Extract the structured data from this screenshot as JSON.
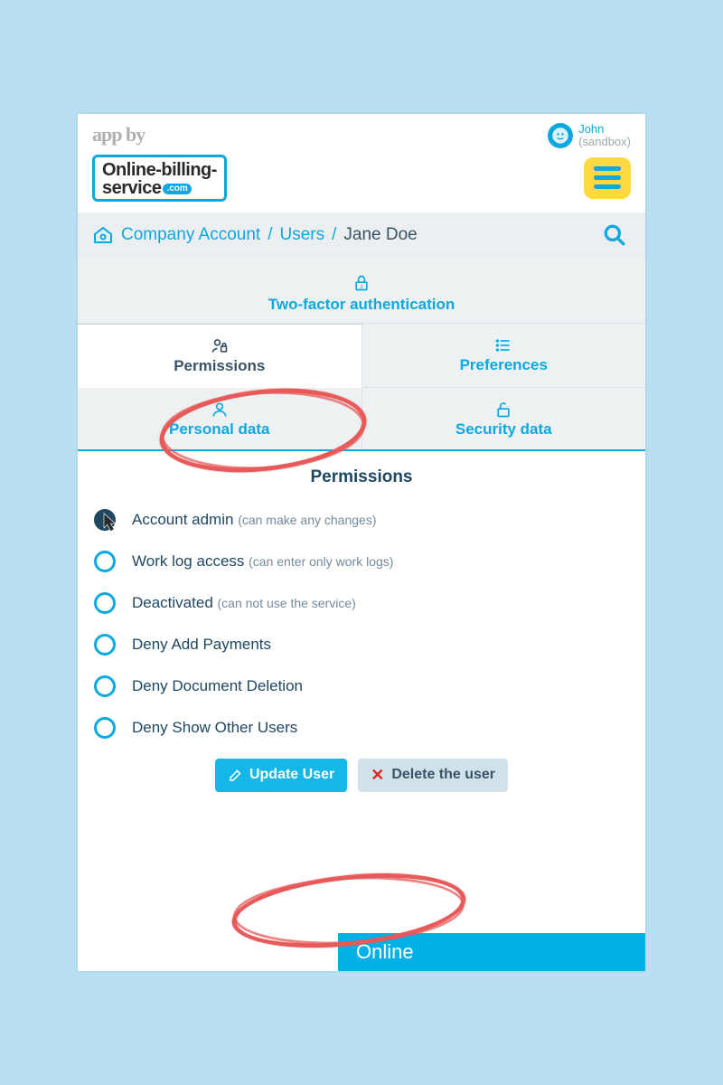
{
  "header": {
    "app_by": "app by",
    "logo_line1": "Online-billing-",
    "logo_line2": "service",
    "logo_suffix": ".com",
    "user_name": "John",
    "user_suffix": "(sandbox)"
  },
  "breadcrumb": {
    "root": "Company Account",
    "mid": "Users",
    "leaf": "Jane Doe"
  },
  "tabs": {
    "two_factor": "Two-factor authentication",
    "permissions": "Permissions",
    "preferences": "Preferences",
    "personal": "Personal data",
    "security": "Security data"
  },
  "panel": {
    "title": "Permissions",
    "items": [
      {
        "label": "Account admin",
        "hint": "(can make any changes)",
        "selected": true
      },
      {
        "label": "Work log access",
        "hint": "(can enter only work logs)",
        "selected": false
      },
      {
        "label": "Deactivated",
        "hint": "(can not use the service)",
        "selected": false
      },
      {
        "label": "Deny Add Payments",
        "hint": "",
        "selected": false
      },
      {
        "label": "Deny Document Deletion",
        "hint": "",
        "selected": false
      },
      {
        "label": "Deny Show Other Users",
        "hint": "",
        "selected": false
      }
    ]
  },
  "buttons": {
    "update": "Update User",
    "delete": "Delete the user"
  },
  "status": {
    "online": "Online"
  }
}
